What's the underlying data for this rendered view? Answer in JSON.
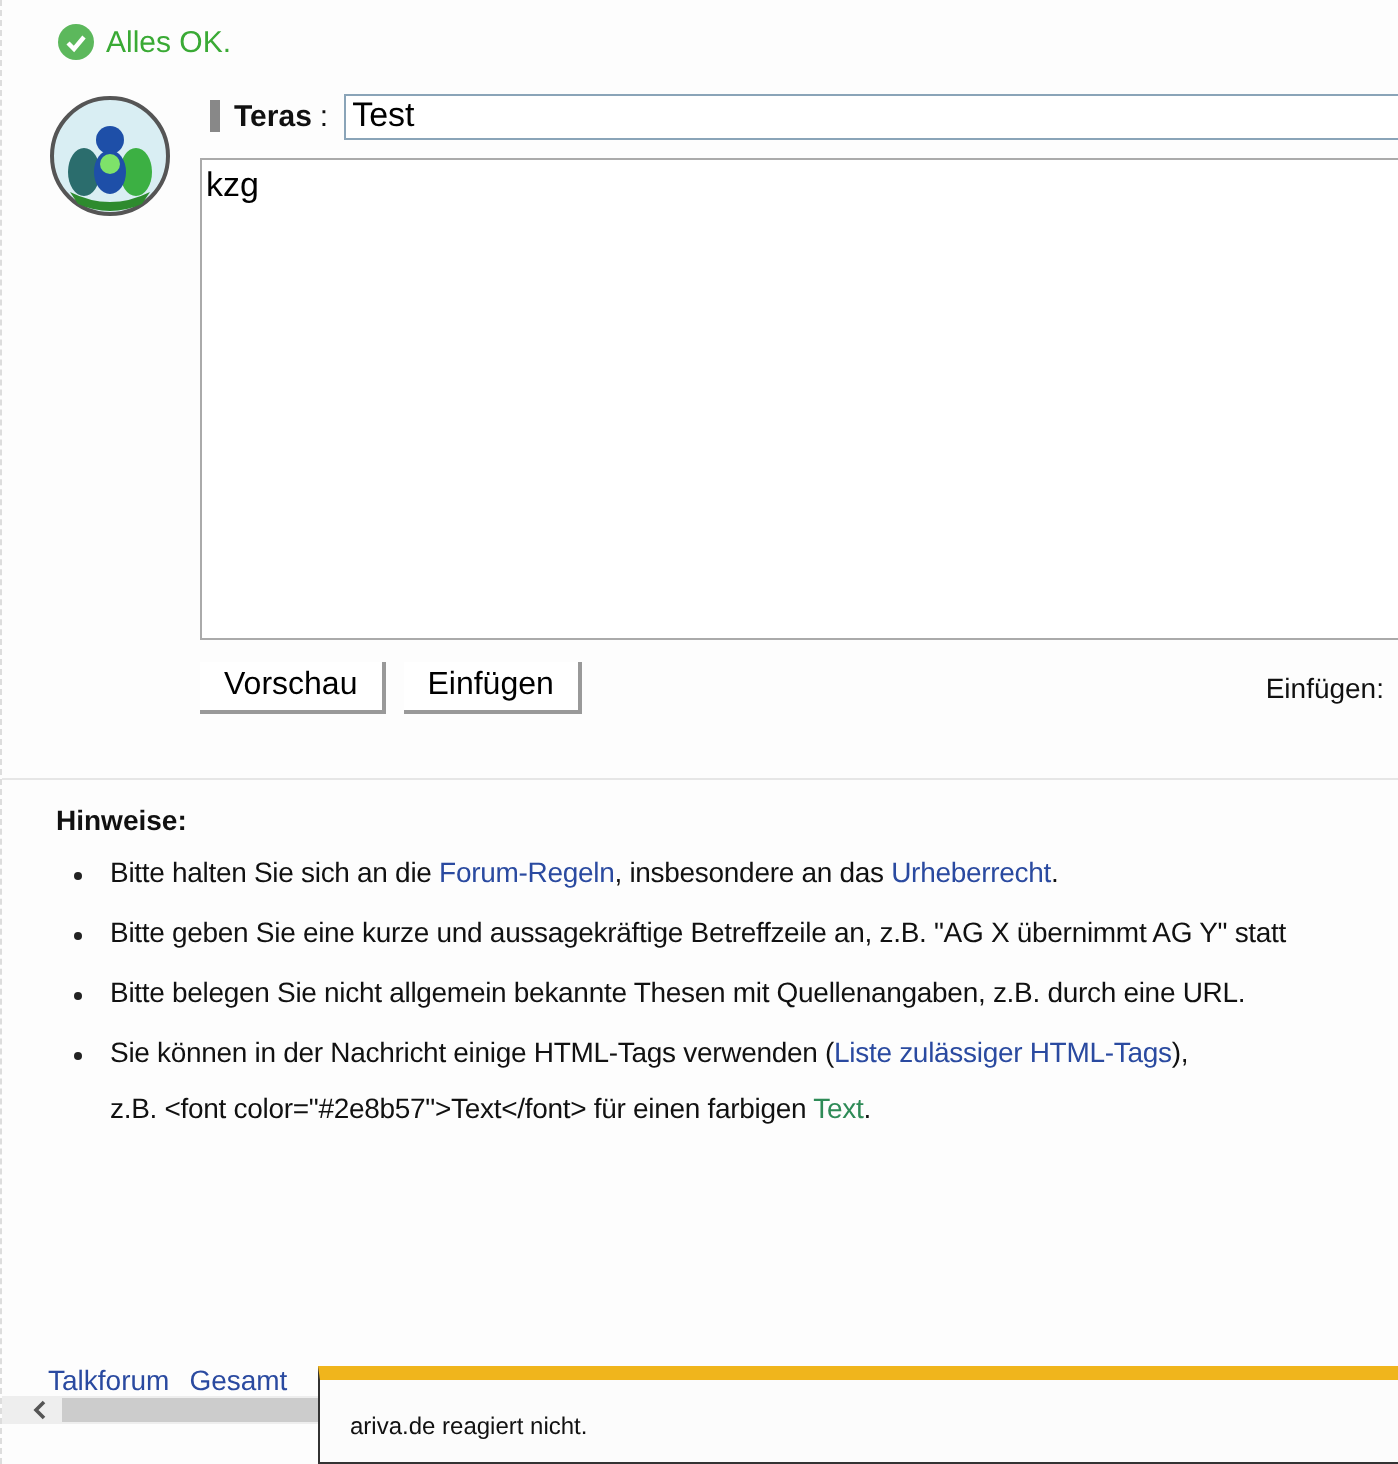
{
  "status": {
    "text": "Alles OK."
  },
  "composer": {
    "user": "Teras",
    "separator": ":",
    "subject_value": "Test",
    "message_value": "kzg",
    "buttons": [
      "Vorschau",
      "Einfügen"
    ],
    "insert_label": "Einfügen:"
  },
  "hints": {
    "title": "Hinweise:",
    "items": [
      {
        "lines": [
          [
            {
              "kind": "text",
              "text": "Bitte halten Sie sich an die "
            },
            {
              "kind": "link",
              "text": "Forum-Regeln"
            },
            {
              "kind": "text",
              "text": ", insbesondere an das "
            },
            {
              "kind": "link",
              "text": "Urheberrecht"
            },
            {
              "kind": "text",
              "text": "."
            }
          ]
        ]
      },
      {
        "lines": [
          [
            {
              "kind": "text",
              "text": "Bitte geben Sie eine kurze und aussagekräftige Betreffzeile an, z.B. \"AG X übernimmt AG Y\" statt"
            }
          ]
        ]
      },
      {
        "lines": [
          [
            {
              "kind": "text",
              "text": "Bitte belegen Sie nicht allgemein bekannte Thesen mit Quellenangaben, z.B. durch eine URL."
            }
          ]
        ]
      },
      {
        "lines": [
          [
            {
              "kind": "text",
              "text": "Sie können in der Nachricht einige HTML-Tags verwenden ("
            },
            {
              "kind": "link",
              "text": "Liste zulässiger HTML-Tags"
            },
            {
              "kind": "text",
              "text": "),"
            }
          ],
          [
            {
              "kind": "text",
              "text": "z.B. <font color=\"#2e8b57\">Text</font> für einen farbigen "
            },
            {
              "kind": "sample",
              "text": "Text",
              "color": "#2e8b57"
            },
            {
              "kind": "text",
              "text": "."
            }
          ]
        ]
      }
    ]
  },
  "footer": {
    "links": [
      "Talkforum",
      "Gesamt"
    ]
  },
  "popup": {
    "message": "ariva.de reagiert nicht."
  }
}
